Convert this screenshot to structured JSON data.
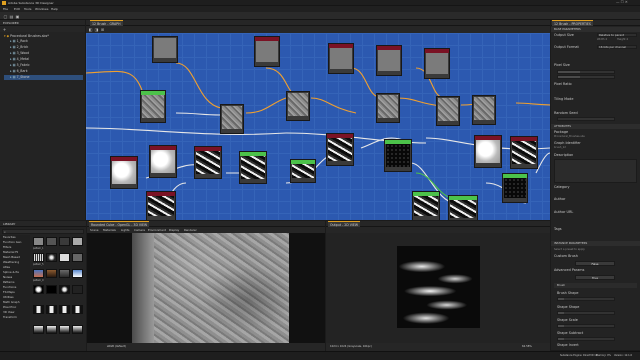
{
  "app": {
    "title": "Adobe Substance 3D Designer",
    "menu": [
      "File",
      "Edit",
      "Tools",
      "Windows",
      "Help"
    ]
  },
  "explorer": {
    "title": "EXPLORER",
    "file": "Procedural Brushes.sbs*",
    "items": [
      "1_Rock",
      "2_Brick",
      "3_Wood",
      "4_Metal",
      "5_Fabric",
      "6_Bark",
      "7_Stone"
    ]
  },
  "graph": {
    "tab": "12 Brush - GRAPH",
    "color": "#2c59b0"
  },
  "properties": {
    "tab": "12 Brush - PROPERTIES",
    "section_base": "BASE PARAMETERS",
    "output_size": "Output Size",
    "output_size_val": "Relative to parent",
    "output_w": "Width 4",
    "output_h": "Height 4",
    "output_format": "Output Format",
    "output_format_val": "16 bits per channel",
    "pixel_size": "Pixel Size",
    "pixel_ratio": "Pixel Ratio",
    "tiling_mode": "Tiling Mode",
    "random_seed": "Random Seed",
    "section_attributes": "ATTRIBUTES",
    "package": "Package",
    "package_val": "Procedural_Brushes.sbs",
    "graph_id": "Graph Identifier",
    "graph_id_val": "brush_12",
    "description": "Description",
    "category": "Category",
    "author": "Author",
    "author_url": "Author URL",
    "tags": "Tags",
    "section_instance": "INSTANCE PARAMETERS",
    "preset_hint": "Select a preset to apply",
    "custom_brush": "Custom Brush",
    "custom_brush_val": "False",
    "advanced_params": "Advanced Params",
    "advanced_params_val": "True",
    "brush_group": "Brush",
    "brush_shape": "Brush Shape",
    "shape_shape": "Shape Shape",
    "shape_scale": "Shape Scale",
    "shape_subtract": "Shape Subtract",
    "shape_invert": "Shape Invert"
  },
  "library": {
    "title": "LIBRARY",
    "categories": [
      "Favorites",
      "Function Gen",
      "Filters",
      "Material Fil",
      "Mesh Based",
      "Weathering",
      "Atlas",
      "Spline & Pa",
      "Noises",
      "Patterns",
      "Functions",
      "FX-Maps",
      "Utilities",
      "Math Graph",
      "Pixel Proc",
      "3D View",
      "Transform"
    ],
    "thumbs": [
      "pattern_1",
      "pattern_2",
      "pattern_3",
      "pattern_4",
      "pattern_5",
      "pattern_6",
      "pattern_7",
      "pattern_8",
      "pattern_9",
      "pattern_10",
      "pattern_11",
      "pattern_12"
    ]
  },
  "view3d": {
    "tab": "Rounded Cube - OpenGL - 3D VIEW",
    "menu": [
      "Scene",
      "Materials",
      "Lights",
      "Camera",
      "Environment",
      "Display",
      "Renderer"
    ],
    "status": "sRGB (default)"
  },
  "view2d": {
    "tab": "Output - 2D VIEW",
    "status": "1024 x 1024 (Grayscale, 16bpc)",
    "zoom": "62.58%"
  },
  "statusbar": {
    "engine": "Substance Engine: Direct3D 11",
    "memory": "Memory: 0%",
    "version": "Version: 12.1.0"
  },
  "colors": {
    "accent": "#e0a020",
    "node_out": "#f0a030",
    "node_green": "#4cc24a",
    "node_red": "#7a1224"
  }
}
